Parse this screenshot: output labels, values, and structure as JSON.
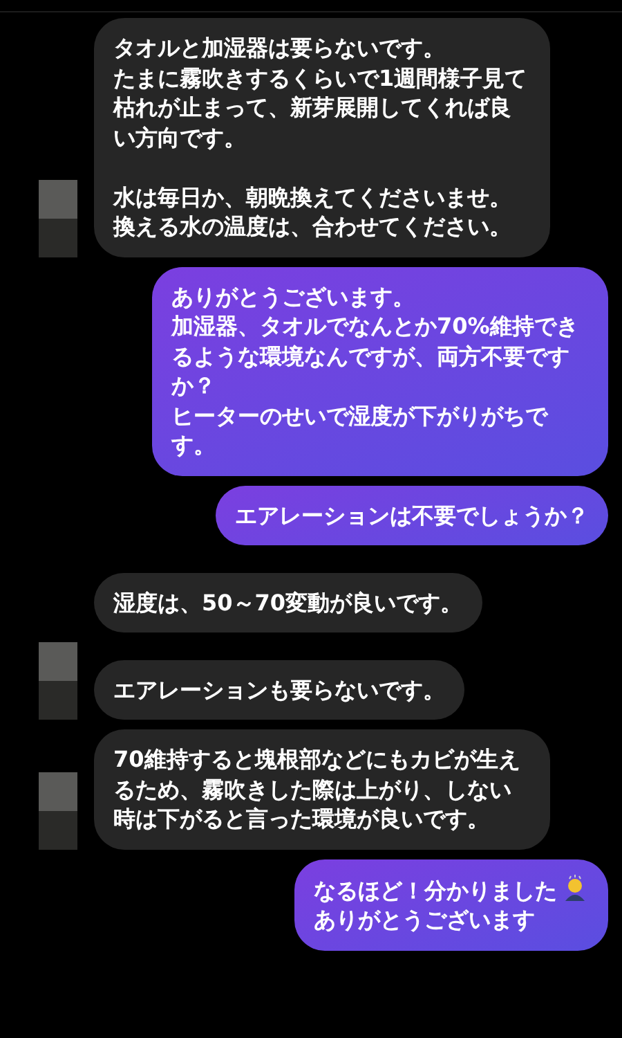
{
  "messages": [
    {
      "kind": "received",
      "lines": [
        "タオルと加湿器は要らないです。",
        "たまに霧吹きするくらいで1週間様子見て枯れが止まって、新芽展開してくれば良い方向です。"
      ],
      "lines_after_gap": [
        "水は毎日か、朝晩換えてくださいませ。",
        "換える水の温度は、合わせてください。"
      ],
      "avatar": true
    },
    {
      "kind": "sent",
      "lines": [
        "ありがとうございます。",
        "加湿器、タオルでなんとか70%維持できるような環境なんですが、両方不要ですか？",
        "ヒーターのせいで湿度が下がりがちです。"
      ],
      "emoji": false
    },
    {
      "kind": "sent",
      "lines": [
        "エアレーションは不要でしょうか？"
      ],
      "emoji": false
    },
    {
      "kind": "received",
      "lines": [
        "湿度は、50～70変動が良いです。"
      ],
      "avatar": false
    },
    {
      "kind": "received",
      "lines": [
        "エアレーションも要らないです。"
      ],
      "avatar": true
    },
    {
      "kind": "received",
      "lines": [
        "70維持すると塊根部などにもカビが生えるため、霧吹きした際は上がり、しない時は下がると言った環境が良いです。"
      ],
      "avatar": true
    },
    {
      "kind": "sent",
      "lines": [
        "なるほど！分かりました",
        "ありがとうございます"
      ],
      "emoji": true
    }
  ]
}
